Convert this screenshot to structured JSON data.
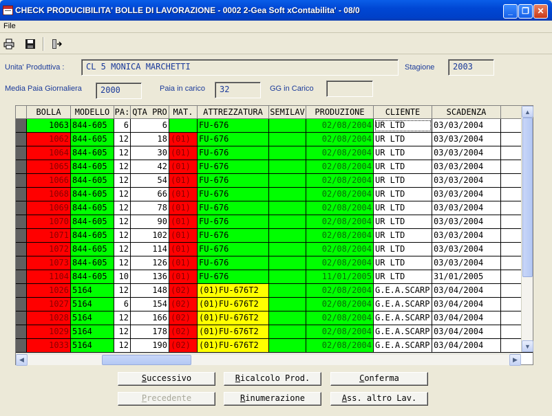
{
  "window": {
    "title": "CHECK PRODUCIBILITA' BOLLE DI LAVORAZIONE - 0002 2-Gea Soft xContabilita' - 08/0"
  },
  "menu": {
    "file": "File"
  },
  "icons": {
    "print": "printer-icon",
    "save": "floppy-disk-icon",
    "exit": "exit-door-icon"
  },
  "form": {
    "unita_label": "Unita' Produttiva :",
    "unita_value": "CL 5 MONICA MARCHETTI",
    "stagione_label": "Stagione",
    "stagione_value": "2003",
    "media_label": "Media Paia Giornaliera",
    "media_value": "2000",
    "paia_label": "Paia in carico",
    "paia_value": "32",
    "gg_label": "GG in Carico",
    "gg_value": ""
  },
  "colors": {
    "red": "#ff0000",
    "green": "#00ff00",
    "yellow": "#ffff00",
    "white": "#ffffff",
    "selector": "#606060"
  },
  "grid": {
    "columns": [
      "BOLLA",
      "MODELLO",
      "PA:",
      "QTA PRO",
      "MAT.",
      "ATTREZZATURA",
      "SEMILAV",
      "PRODUZIONE",
      "CLIENTE",
      "SCADENZA"
    ],
    "rows": [
      {
        "bolla": "1063",
        "modello": "844-605",
        "pa": "6",
        "qta": "6",
        "mat": "",
        "attr": "FU-676",
        "prod": "02/08/2004",
        "cliente": "UR LTD",
        "scad": "03/03/2004",
        "c": [
          "green",
          "green",
          "white",
          "white",
          "green",
          "green",
          "green",
          "green",
          "white",
          "white"
        ]
      },
      {
        "bolla": "1062",
        "modello": "844-605",
        "pa": "12",
        "qta": "18",
        "mat": "(01)",
        "attr": "FU-676",
        "prod": "02/08/2004",
        "cliente": "UR LTD",
        "scad": "03/03/2004",
        "c": [
          "red",
          "green",
          "white",
          "white",
          "red",
          "green",
          "green",
          "green",
          "white",
          "white"
        ]
      },
      {
        "bolla": "1064",
        "modello": "844-605",
        "pa": "12",
        "qta": "30",
        "mat": "(01)",
        "attr": "FU-676",
        "prod": "02/08/2004",
        "cliente": "UR LTD",
        "scad": "03/03/2004",
        "c": [
          "red",
          "green",
          "white",
          "white",
          "red",
          "green",
          "green",
          "green",
          "white",
          "white"
        ]
      },
      {
        "bolla": "1065",
        "modello": "844-605",
        "pa": "12",
        "qta": "42",
        "mat": "(01)",
        "attr": "FU-676",
        "prod": "02/08/2004",
        "cliente": "UR LTD",
        "scad": "03/03/2004",
        "c": [
          "red",
          "green",
          "white",
          "white",
          "red",
          "green",
          "green",
          "green",
          "white",
          "white"
        ]
      },
      {
        "bolla": "1066",
        "modello": "844-605",
        "pa": "12",
        "qta": "54",
        "mat": "(01)",
        "attr": "FU-676",
        "prod": "02/08/2004",
        "cliente": "UR LTD",
        "scad": "03/03/2004",
        "c": [
          "red",
          "green",
          "white",
          "white",
          "red",
          "green",
          "green",
          "green",
          "white",
          "white"
        ]
      },
      {
        "bolla": "1068",
        "modello": "844-605",
        "pa": "12",
        "qta": "66",
        "mat": "(01)",
        "attr": "FU-676",
        "prod": "02/08/2004",
        "cliente": "UR LTD",
        "scad": "03/03/2004",
        "c": [
          "red",
          "green",
          "white",
          "white",
          "red",
          "green",
          "green",
          "green",
          "white",
          "white"
        ]
      },
      {
        "bolla": "1069",
        "modello": "844-605",
        "pa": "12",
        "qta": "78",
        "mat": "(01)",
        "attr": "FU-676",
        "prod": "02/08/2004",
        "cliente": "UR LTD",
        "scad": "03/03/2004",
        "c": [
          "red",
          "green",
          "white",
          "white",
          "red",
          "green",
          "green",
          "green",
          "white",
          "white"
        ]
      },
      {
        "bolla": "1070",
        "modello": "844-605",
        "pa": "12",
        "qta": "90",
        "mat": "(01)",
        "attr": "FU-676",
        "prod": "02/08/2004",
        "cliente": "UR LTD",
        "scad": "03/03/2004",
        "c": [
          "red",
          "green",
          "white",
          "white",
          "red",
          "green",
          "green",
          "green",
          "white",
          "white"
        ]
      },
      {
        "bolla": "1071",
        "modello": "844-605",
        "pa": "12",
        "qta": "102",
        "mat": "(01)",
        "attr": "FU-676",
        "prod": "02/08/2004",
        "cliente": "UR LTD",
        "scad": "03/03/2004",
        "c": [
          "red",
          "green",
          "white",
          "white",
          "red",
          "green",
          "green",
          "green",
          "white",
          "white"
        ]
      },
      {
        "bolla": "1072",
        "modello": "844-605",
        "pa": "12",
        "qta": "114",
        "mat": "(01)",
        "attr": "FU-676",
        "prod": "02/08/2004",
        "cliente": "UR LTD",
        "scad": "03/03/2004",
        "c": [
          "red",
          "green",
          "white",
          "white",
          "red",
          "green",
          "green",
          "green",
          "white",
          "white"
        ]
      },
      {
        "bolla": "1073",
        "modello": "844-605",
        "pa": "12",
        "qta": "126",
        "mat": "(01)",
        "attr": "FU-676",
        "prod": "02/08/2004",
        "cliente": "UR LTD",
        "scad": "03/03/2004",
        "c": [
          "red",
          "green",
          "white",
          "white",
          "red",
          "green",
          "green",
          "green",
          "white",
          "white"
        ]
      },
      {
        "bolla": "1104",
        "modello": "844-605",
        "pa": "10",
        "qta": "136",
        "mat": "(01)",
        "attr": "FU-676",
        "prod": "11/01/2005",
        "cliente": "UR LTD",
        "scad": "31/01/2005",
        "c": [
          "red",
          "green",
          "white",
          "white",
          "red",
          "green",
          "green",
          "green",
          "white",
          "white"
        ]
      },
      {
        "bolla": "1026",
        "modello": "5164",
        "pa": "12",
        "qta": "148",
        "mat": "(02)",
        "attr": "(01)FU-676T2",
        "prod": "02/08/2004",
        "cliente": "G.E.A.SCARP",
        "scad": "03/04/2004",
        "c": [
          "red",
          "green",
          "white",
          "white",
          "red",
          "yellow",
          "green",
          "green",
          "white",
          "white"
        ]
      },
      {
        "bolla": "1027",
        "modello": "5164",
        "pa": "6",
        "qta": "154",
        "mat": "(02)",
        "attr": "(01)FU-676T2",
        "prod": "02/08/2004",
        "cliente": "G.E.A.SCARP",
        "scad": "03/04/2004",
        "c": [
          "red",
          "green",
          "white",
          "white",
          "red",
          "yellow",
          "green",
          "green",
          "white",
          "white"
        ]
      },
      {
        "bolla": "1028",
        "modello": "5164",
        "pa": "12",
        "qta": "166",
        "mat": "(02)",
        "attr": "(01)FU-676T2",
        "prod": "02/08/2004",
        "cliente": "G.E.A.SCARP",
        "scad": "03/04/2004",
        "c": [
          "red",
          "green",
          "white",
          "white",
          "red",
          "yellow",
          "green",
          "green",
          "white",
          "white"
        ]
      },
      {
        "bolla": "1029",
        "modello": "5164",
        "pa": "12",
        "qta": "178",
        "mat": "(02)",
        "attr": "(01)FU-676T2",
        "prod": "02/08/2004",
        "cliente": "G.E.A.SCARP",
        "scad": "03/04/2004",
        "c": [
          "red",
          "green",
          "white",
          "white",
          "red",
          "yellow",
          "green",
          "green",
          "white",
          "white"
        ]
      },
      {
        "bolla": "1033",
        "modello": "5164",
        "pa": "12",
        "qta": "190",
        "mat": "(02)",
        "attr": "(01)FU-676T2",
        "prod": "02/08/2004",
        "cliente": "G.E.A.SCARP",
        "scad": "03/04/2004",
        "c": [
          "red",
          "green",
          "white",
          "white",
          "red",
          "yellow",
          "green",
          "green",
          "white",
          "white"
        ]
      }
    ]
  },
  "buttons": {
    "successivo": "Successivo",
    "ricalcolo": "Ricalcolo Prod.",
    "conferma": "Conferma",
    "precedente": "Precedente",
    "rinumerazione": "Rinumerazione",
    "ass_altro": "Ass. altro Lav."
  }
}
